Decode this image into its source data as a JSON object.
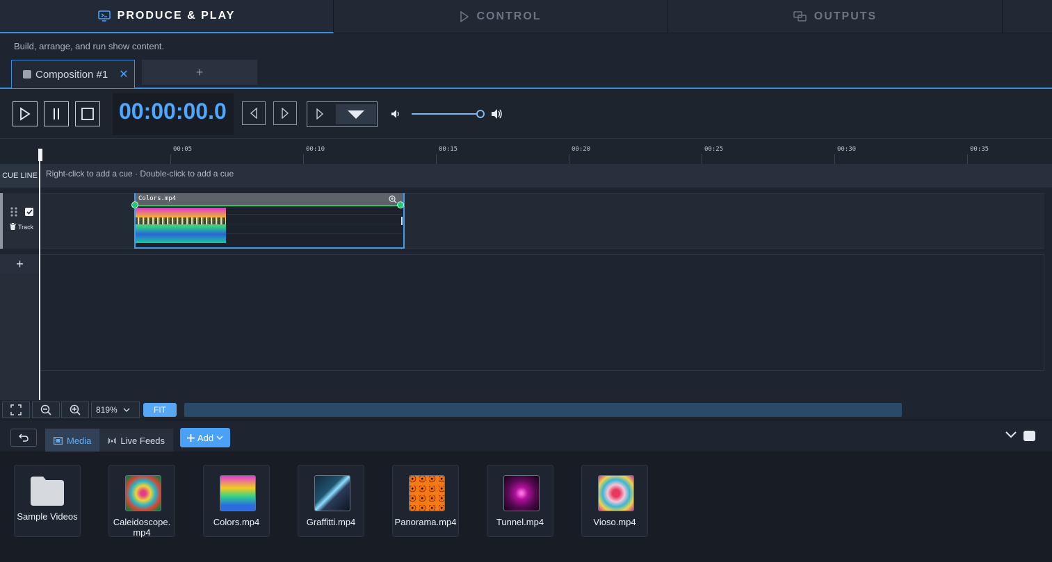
{
  "top_tabs": [
    {
      "label": "PRODUCE & PLAY",
      "icon": "monitor-icon",
      "active": true
    },
    {
      "label": "CONTROL",
      "icon": "play-outline-icon",
      "active": false
    },
    {
      "label": "OUTPUTS",
      "icon": "outputs-icon",
      "active": false
    }
  ],
  "subtitle": "Build, arrange, and run show content.",
  "composition_tabs": {
    "active_label": "Composition #1",
    "close_symbol": "✕",
    "add_symbol": "+"
  },
  "transport": {
    "timecode": "00:00:00.0",
    "volume_level": 1.0
  },
  "ruler": {
    "ticks": [
      "00:05",
      "00:10",
      "00:15",
      "00:20",
      "00:25",
      "00:30",
      "00:35"
    ]
  },
  "cue_line": {
    "label": "CUE LINE",
    "hint": "Right-click to add a cue · Double-click to add a cue"
  },
  "track": {
    "label": "Track",
    "enabled": true,
    "add_symbol": "+"
  },
  "clip": {
    "name": "Colors.mp4"
  },
  "zoom": {
    "value": "819%",
    "fit_label": "FIT"
  },
  "media_bar": {
    "tabs": [
      {
        "label": "Media",
        "icon": "film-icon",
        "active": true
      },
      {
        "label": "Live Feeds",
        "icon": "broadcast-icon",
        "active": false
      }
    ],
    "add_label": "Add"
  },
  "media_items": [
    {
      "label": "Sample Videos",
      "kind": "folder"
    },
    {
      "label": "Caleidoscope.mp4",
      "kind": "video"
    },
    {
      "label": "Colors.mp4",
      "kind": "video"
    },
    {
      "label": "Graffitti.mp4",
      "kind": "video"
    },
    {
      "label": "Panorama.mp4",
      "kind": "video"
    },
    {
      "label": "Tunnel.mp4",
      "kind": "video"
    },
    {
      "label": "Vioso.mp4",
      "kind": "video"
    }
  ],
  "colors": {
    "accent": "#3d8fe0",
    "timecode": "#4ea8ff",
    "clip_handle": "#1fca75"
  }
}
